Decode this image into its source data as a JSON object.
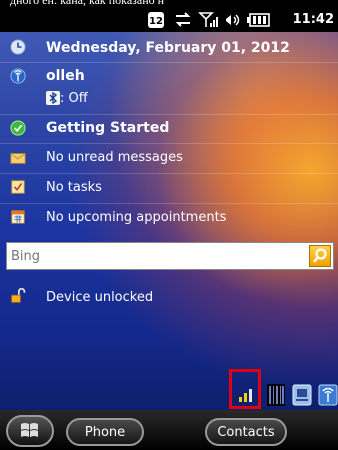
{
  "caption": "дного ен: кана, как показано н",
  "status": {
    "clock": "11:42",
    "badge_number": "12"
  },
  "today": {
    "date": "Wednesday, February 01, 2012",
    "operator": "olleh",
    "bluetooth_label": ": Off",
    "getting_started": "Getting Started",
    "messages": "No unread messages",
    "tasks": "No tasks",
    "appointments": "No upcoming appointments",
    "device": "Device unlocked"
  },
  "search": {
    "placeholder": "Bing"
  },
  "softkeys": {
    "left": "Phone",
    "right": "Contacts"
  }
}
